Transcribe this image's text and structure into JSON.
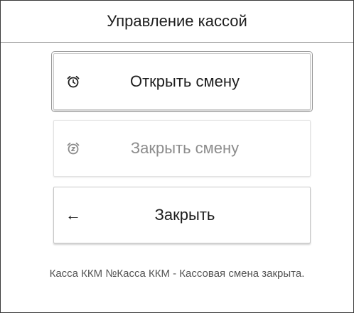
{
  "window": {
    "title": "Управление кассой"
  },
  "buttons": {
    "open_shift": {
      "label": "Открыть смену",
      "icon": "alarm-clock-icon"
    },
    "close_shift": {
      "label": "Закрыть смену",
      "icon": "alarm-snooze-icon",
      "state": "disabled"
    },
    "close": {
      "label": "Закрыть",
      "icon": "arrow-left-icon",
      "glyph": "←"
    }
  },
  "status": {
    "text": "Касса ККМ №Касса ККМ - Кассовая смена закрыта."
  },
  "colors": {
    "text": "#1e1e1e",
    "disabled_text": "#8c8c8c",
    "border": "#3a3a3a"
  }
}
